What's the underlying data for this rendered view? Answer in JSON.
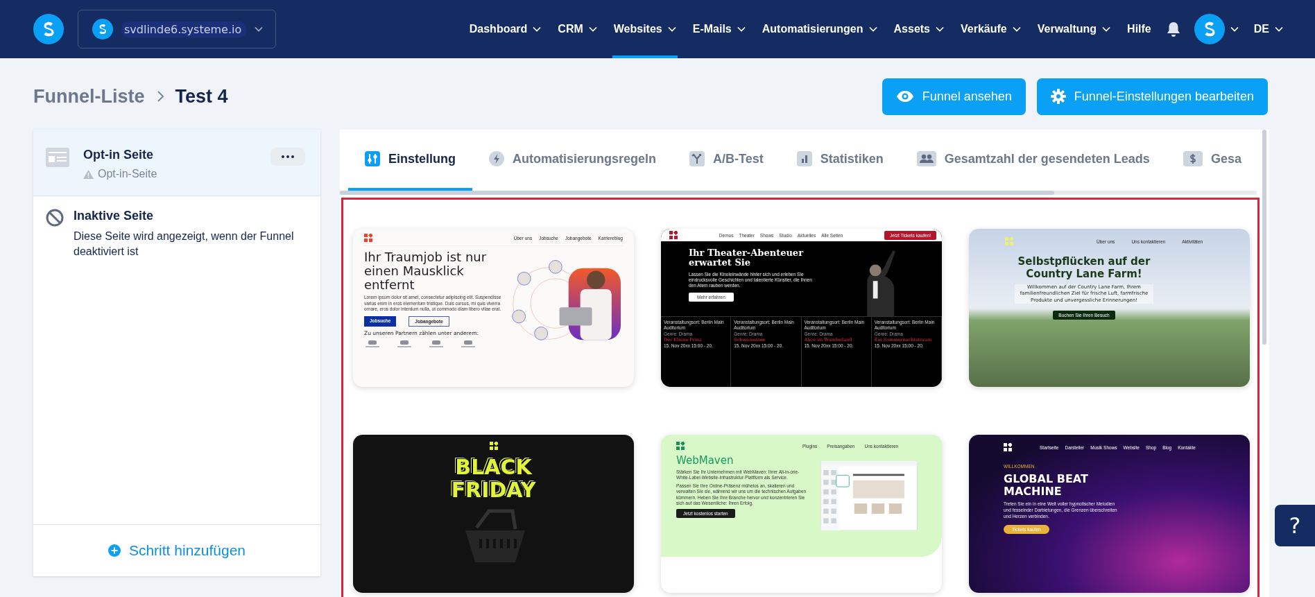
{
  "header": {
    "account": "svdlinde6.systeme.io",
    "nav": [
      {
        "label": "Dashboard",
        "dropdown": true,
        "selected": false
      },
      {
        "label": "CRM",
        "dropdown": true,
        "selected": false
      },
      {
        "label": "Websites",
        "dropdown": true,
        "selected": true
      },
      {
        "label": "E-Mails",
        "dropdown": true,
        "selected": false
      },
      {
        "label": "Automatisierungen",
        "dropdown": true,
        "selected": false
      },
      {
        "label": "Assets",
        "dropdown": true,
        "selected": false
      },
      {
        "label": "Verkäufe",
        "dropdown": true,
        "selected": false
      },
      {
        "label": "Verwaltung",
        "dropdown": true,
        "selected": false
      },
      {
        "label": "Hilfe",
        "dropdown": false,
        "selected": false
      }
    ],
    "language": "DE"
  },
  "breadcrumb": [
    "Funnel-Liste",
    "Test 4"
  ],
  "actions": [
    "Funnel ansehen",
    "Funnel-Einstellungen bearbeiten"
  ],
  "sidebar": {
    "steps": [
      {
        "title": "Opt-in Seite",
        "subtitle": "Opt-in-Seite",
        "selected": true
      }
    ],
    "inactive": {
      "title": "Inaktive Seite",
      "description": "Diese Seite wird angezeigt, wenn der Funnel deaktiviert ist"
    },
    "add_step": "Schritt hinzufügen"
  },
  "tabs": [
    {
      "label": "Einstellung",
      "selected": true
    },
    {
      "label": "Automatisierungsregeln",
      "selected": false
    },
    {
      "label": "A/B-Test",
      "selected": false
    },
    {
      "label": "Statistiken",
      "selected": false
    },
    {
      "label": "Gesamtzahl der gesendeten Leads",
      "selected": false
    },
    {
      "label": "Gesa",
      "selected": false
    }
  ],
  "templates": [
    {
      "kind": "job",
      "nav": [
        "Über uns",
        "Jobsuche",
        "Jobangebote",
        "Karriereblog"
      ],
      "headline": "Ihr Traumjob ist nur einen Mausklick entfernt",
      "body": "Lorem ipsum dolor sit amet, consectetur adipiscing elit. Suspendisse varius enim in eros elementum tristique. Duis cursus, mi quis viverra ornare, eros dolor interdum nulla, ut commodo diam libero vitae erat.",
      "buttons": [
        "Jobsuche",
        "Jobangebote"
      ],
      "note": "Zu unseren Partnern zählen unter anderem:"
    },
    {
      "kind": "theater",
      "nav": [
        "Demos",
        "Theater",
        "Shows",
        "Studio",
        "Aktuelles",
        "Alle Seiten"
      ],
      "cta": "Jetzt Tickets kaufen!",
      "headline": "Ihr Theater-Abenteuer erwartet Sie",
      "body": "Lassen Sie die Kinoleinwände hinter sich und erleben Sie eindrucksvolle Geschichten und talentierte Künstler, die Ihnen den Atem rauben werden.",
      "buttons": [
        "Mehr erfahren"
      ],
      "events": [
        {
          "venue": "Veranstaltungsort: Berlin Main Auditorium",
          "genre": "Genre: Drama",
          "title": "Der Kleine Prinz",
          "date": "15. Nov 20xx 15:00 - 20."
        },
        {
          "venue": "Veranstaltungsort: Berlin Main Auditorium",
          "genre": "Genre: Drama",
          "title": "Schwanensee",
          "date": "15. Nov 20xx 15:00 - 20."
        },
        {
          "venue": "Veranstaltungsort: Berlin Main Auditorium",
          "genre": "Genre: Drama",
          "title": "Alice im Wunderland",
          "date": "15. Nov 20xx 15:00 - 20."
        },
        {
          "venue": "Veranstaltungsort: Berlin Main Auditorium",
          "genre": "Genre: Drama",
          "title": "Ein Sommernachtstraum",
          "date": "15. Nov 20xx 15:00 - 20."
        }
      ]
    },
    {
      "kind": "farm",
      "nav": [
        "Über uns",
        "Uns kontaktieren",
        "Aktivitäten"
      ],
      "headline": "Selbstpflücken auf der Country Lane Farm!",
      "body": "Willkommen auf der Country Lane Farm, Ihrem familienfreundlichen Ziel für frische Luft, farmfrische Produkte und unvergessliche Erinnerungen!",
      "buttons": [
        "Buchen Sie Ihren Besuch"
      ]
    },
    {
      "kind": "blackfriday",
      "headline": "BLACK FRIDAY"
    },
    {
      "kind": "webmaven",
      "nav": [
        "Plugins",
        "Preisangaben",
        "Uns kontaktieren"
      ],
      "headline": "WebMaven",
      "paragraphs": [
        "Stärken Sie Ihr Unternehmen mit WebMaven: Ihrer All-in-one-White-Label-Website-Infrastruktur-Plattform als Service.",
        "Passen Sie Ihre Online-Präsenz mühelos an, skalieren und verwalten Sie sie, während wir uns um die technischen Aufgaben kümmern. Heben Sie Ihre Branche hervor und konzentrieren Sie sich auf das Wesentliche: Ihren Erfolg."
      ],
      "buttons": [
        "Jetzt kostenlos starten"
      ]
    },
    {
      "kind": "beat",
      "nav": [
        "Startseite",
        "Darsteller",
        "Musik Shows",
        "Website",
        "Shop",
        "Blog",
        "Kontakte"
      ],
      "kicker": "WILLKOMMEN",
      "headline": "GLOBAL BEAT MACHINE",
      "body": "Treten Sie ein in eine Welt voller hypnotischer Melodien und fesselnder Darbietungen, die Grenzen überschreiten und Herzen verbinden.",
      "buttons": [
        "Tickets kaufen"
      ]
    }
  ],
  "help_button": "?"
}
